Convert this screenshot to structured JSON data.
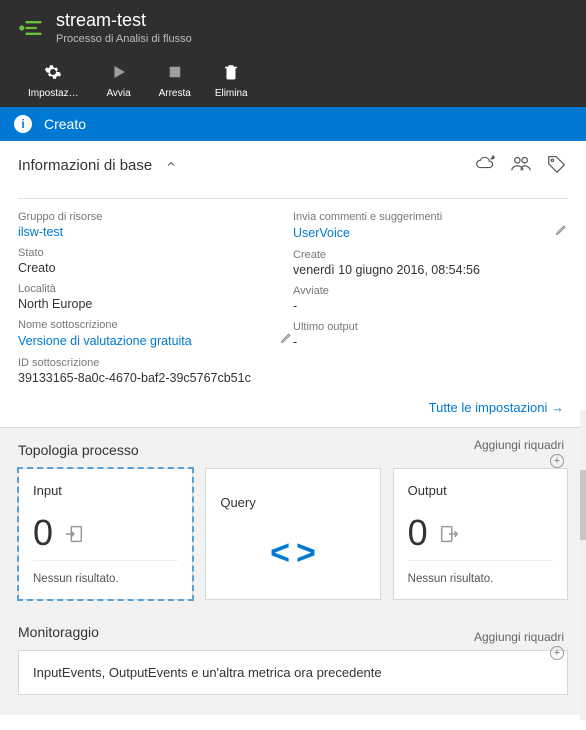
{
  "header": {
    "title": "stream-test",
    "subtitle": "Processo di Analisi di flusso"
  },
  "toolbar": {
    "settings": "Impostaz…",
    "start": "Avvia",
    "stop": "Arresta",
    "delete": "Elimina"
  },
  "status_bar": {
    "text": "Creato"
  },
  "section": {
    "title": "Informazioni di base"
  },
  "info": {
    "left": {
      "resource_group_label": "Gruppo di risorse",
      "resource_group_value": "ilsw-test",
      "state_label": "Stato",
      "state_value": "Creato",
      "location_label": "Località",
      "location_value": "North Europe",
      "subscription_name_label": "Nome sottoscrizione",
      "subscription_name_value": "Versione di valutazione gratuita",
      "subscription_id_label": "ID sottoscrizione",
      "subscription_id_value": "39133165-8a0c-4670-baf2-39c5767cb51c"
    },
    "right": {
      "feedback_label": "Invia commenti e suggerimenti",
      "feedback_value": "UserVoice",
      "create_label": "Create",
      "create_value": "venerdì 10 giugno 2016, 08:54:56",
      "started_label": "Avviate",
      "started_value": "-",
      "last_output_label": "Ultimo output",
      "last_output_value": "-"
    }
  },
  "all_settings": "Tutte le impostazioni",
  "topology": {
    "title": "Topologia processo",
    "add_tiles": "Aggiungi riquadri",
    "tiles": {
      "input": {
        "title": "Input",
        "count": "0",
        "footer": "Nessun risultato."
      },
      "query": {
        "title": "Query"
      },
      "output": {
        "title": "Output",
        "count": "0",
        "footer": "Nessun risultato."
      }
    }
  },
  "monitoring": {
    "title": "Monitoraggio",
    "add_tiles": "Aggiungi riquadri",
    "metric_text": "InputEvents, OutputEvents e un'altra metrica ora precedente"
  }
}
